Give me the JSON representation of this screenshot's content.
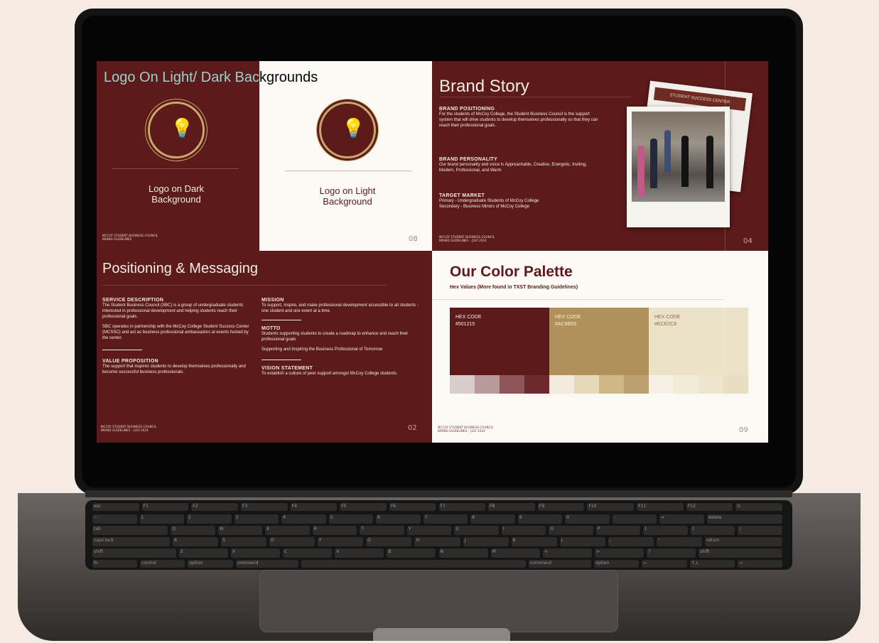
{
  "slides": {
    "logo": {
      "title": "Logo On Light/ Dark Backgrounds",
      "dark_caption": "Logo on Dark Background",
      "light_caption": "Logo on Light Background",
      "footer_line1": "MCCOY STUDENT BUSINESS COUNCIL",
      "footer_line2": "BRAND GUIDELINES",
      "page": "08"
    },
    "story": {
      "title": "Brand Story",
      "positioning_label": "BRAND POSITIONING",
      "positioning_text": "For the students of McCoy College, the Student Business Council is the support system that will drive students to develop themselves professionally so that they can reach their professional goals.",
      "personality_label": "BRAND PERSONALITY",
      "personality_text": "Our brand personality and voice is Approachable, Creative, Energetic, Inviting, Modern, Professional, and Warm",
      "market_label": "TARGET MARKET",
      "market_line1": "Primary - Undergraduate Students of McCoy College",
      "market_line2": "Secondary - Business Minors of McCoy College",
      "photo_sign": "STUDENT SUCCESS CENTER",
      "footer_line1": "MCCOY STUDENT BUSINESS COUNCIL",
      "footer_line2": "BRAND GUIDELINES – JULY 2024",
      "page": "04"
    },
    "positioning": {
      "title": "Positioning & Messaging",
      "service_label": "SERVICE DESCRIPTION",
      "service_text1": "The Student Business Council (SBC) is a group of undergraduate students interested in professional development and helping students reach their professional goals.",
      "service_text2": "SBC operates in partnership with the McCoy College Student Success Center (MCSSC) and act as business professional ambassadors at events hosted by the center.",
      "value_label": "VALUE PROPOSITION",
      "value_text": "The support that inspires students to develop themselves professionally and become successful business professionals.",
      "mission_label": "MISSION",
      "mission_text": "To support, inspire, and make professional development accessible to all students - one student and one event at a time.",
      "motto_label": "MOTTO",
      "motto_text1": "Students supporting students to create a roadmap to enhance and reach their professional goals",
      "motto_text2": "Supporting and Inspiring the Business Professional of Tomorrow",
      "vision_label": "VISION STATEMENT",
      "vision_text": "To establish a culture of peer support amongst McCoy College students.",
      "footer_line1": "MCCOY STUDENT BUSINESS COUNCIL",
      "footer_line2": "BRAND GUIDELINES – JULY 2024",
      "page": "02"
    },
    "palette": {
      "title": "Our Color Palette",
      "subtitle": "Hex Values (More found in TXST Branding Guidelines)",
      "swatches": [
        {
          "label": "HEX CODE",
          "hex": "#501215",
          "color": "#5c1a1a",
          "tints": [
            "#d9cccc",
            "#b99a9a",
            "#8c5557",
            "#6c2a2d"
          ]
        },
        {
          "label": "HEX CODE",
          "hex": "#AC8B55",
          "color": "#b0915a",
          "tints": [
            "#f3ebdd",
            "#e6d8b9",
            "#cfb886",
            "#bba06d"
          ]
        },
        {
          "label": "HEX CODE",
          "hex": "#ECE2C8",
          "color": "#ece2c8",
          "tints": [
            "#f6f1e4",
            "#f2ebda",
            "#eee5cf",
            "#e9ddc0"
          ]
        }
      ],
      "footer_line1": "MCCOY STUDENT BUSINESS COUNCIL",
      "footer_line2": "BRAND GUIDELINES – JULY 2024",
      "page": "09"
    }
  },
  "keyboard": {
    "rows": [
      [
        "esc",
        "F1",
        "F2",
        "F3",
        "F4",
        "F5",
        "F6",
        "F7",
        "F8",
        "F9",
        "F10",
        "F11",
        "F12",
        "⏻"
      ],
      [
        "~",
        "1",
        "2",
        "3",
        "4",
        "5",
        "6",
        "7",
        "8",
        "9",
        "0",
        "-",
        "=",
        "delete"
      ],
      [
        "tab",
        "Q",
        "W",
        "E",
        "R",
        "T",
        "Y",
        "U",
        "I",
        "O",
        "P",
        "[",
        "]",
        "\\"
      ],
      [
        "caps lock",
        "A",
        "S",
        "D",
        "F",
        "G",
        "H",
        "J",
        "K",
        "L",
        ";",
        "'",
        "return"
      ],
      [
        "shift",
        "Z",
        "X",
        "C",
        "V",
        "B",
        "N",
        "M",
        "<",
        ">",
        "?",
        "shift"
      ],
      [
        "fn",
        "control",
        "option",
        "command",
        "",
        "command",
        "option",
        "←",
        "↑↓",
        "→"
      ]
    ]
  },
  "colors": {
    "maroon": "#5c1a1a",
    "gold": "#c9a86a",
    "cream": "#fbf9f4"
  }
}
